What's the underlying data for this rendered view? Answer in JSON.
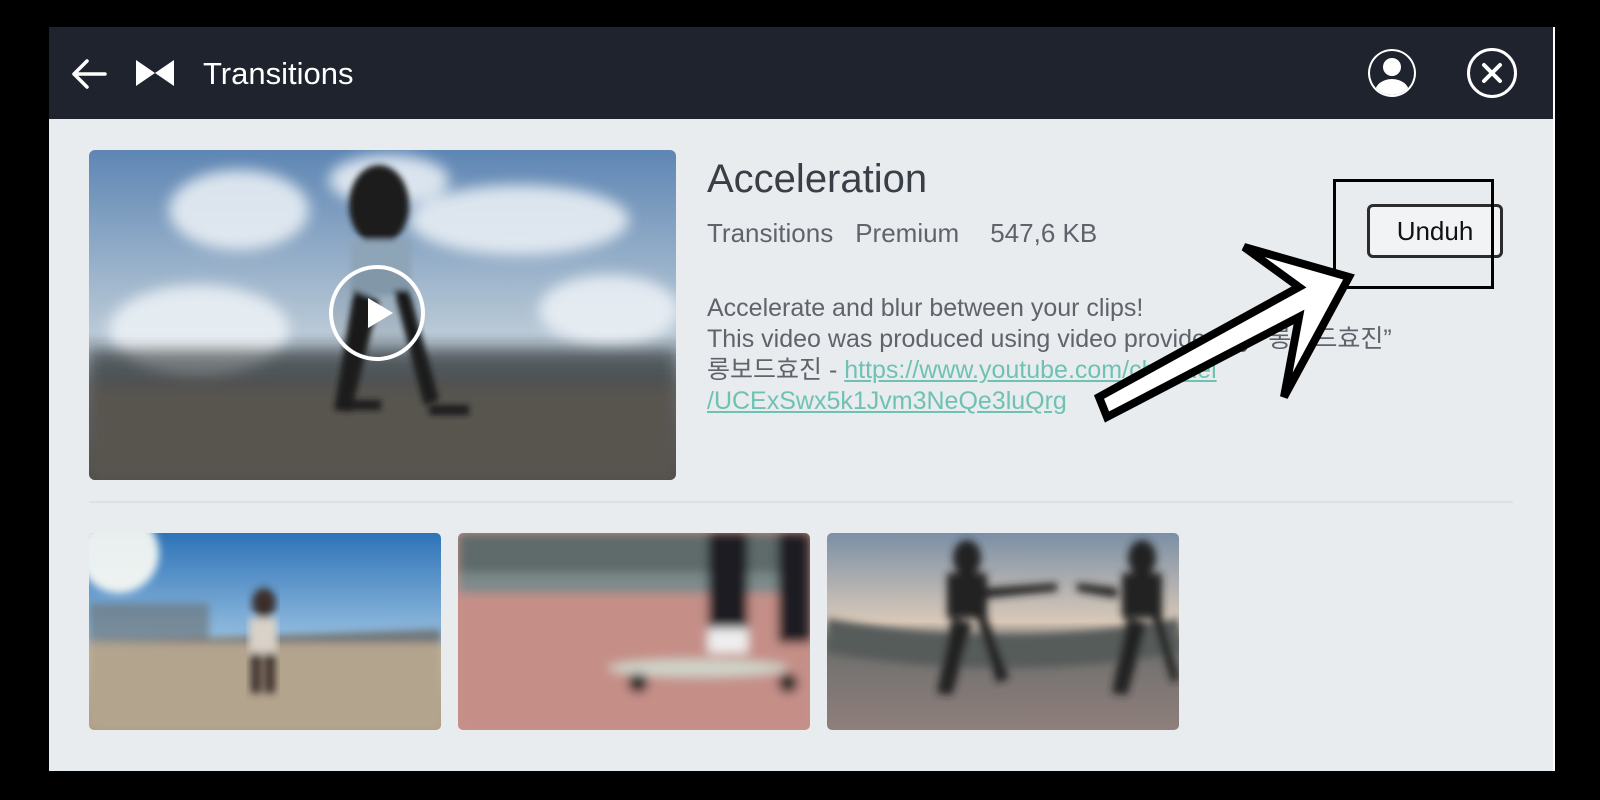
{
  "header": {
    "title": "Transitions"
  },
  "effect": {
    "name": "Acceleration",
    "category": "Transitions",
    "tier": "Premium",
    "size": "547,6 KB",
    "download_label": "Unduh",
    "description_line1": "Accelerate and blur between your clips!",
    "description_line2": "This video was produced using video provided by “롱보드효진”",
    "credit_prefix": "롱보드효진 - ",
    "credit_link_line1": "https://www.youtube.com/channel",
    "credit_link_line2": "/UCExSwx5k1Jvm3NeQe3luQrg"
  },
  "icons": {
    "back": "arrow-left-icon",
    "logo": "bowtie-logo-icon",
    "account": "user-circle-icon",
    "close": "close-circle-icon",
    "play": "play-circle-icon"
  },
  "colors": {
    "header_bg": "#1f232d",
    "content_bg": "#e9ecef",
    "link": "#6fc2b3",
    "text_primary": "#3a3f47",
    "text_secondary": "#5f646c"
  }
}
